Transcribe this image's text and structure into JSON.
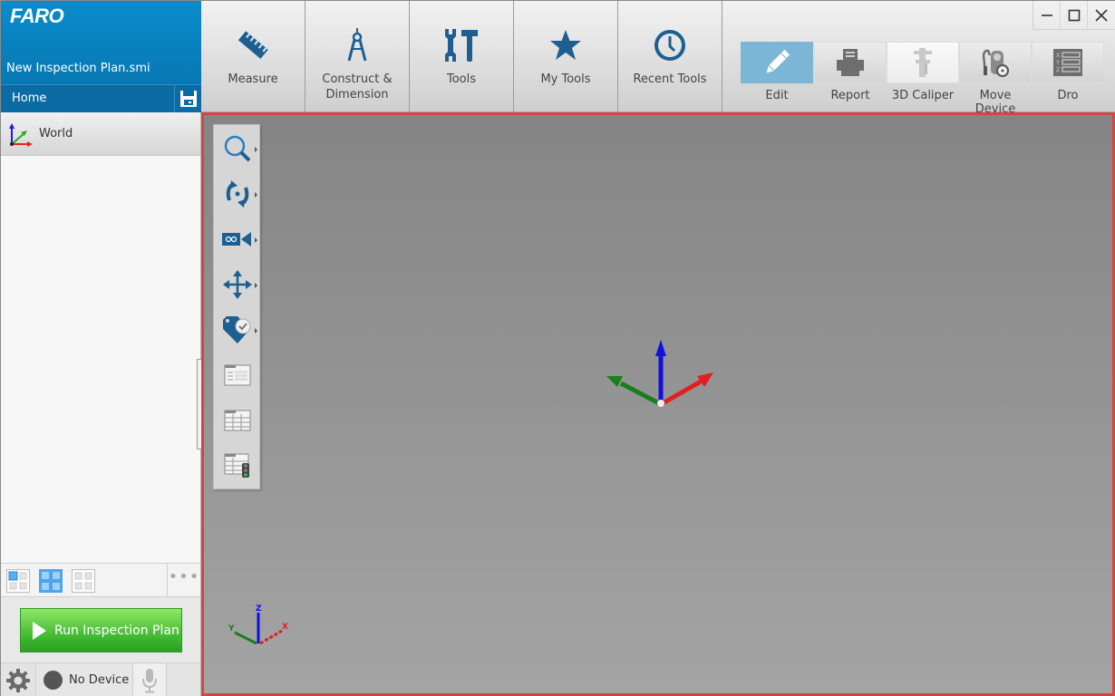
{
  "app": {
    "logo": "FARO",
    "plan_name": "New Inspection Plan.smi",
    "home_label": "Home"
  },
  "tree": {
    "root": {
      "label": "World",
      "icon": "coordinate-axes-icon"
    }
  },
  "ribbon": {
    "groups": [
      {
        "label": "Measure",
        "icon": "ruler-icon"
      },
      {
        "label": "Construct &\nDimension",
        "icon": "compass-icon"
      },
      {
        "label": "Tools",
        "icon": "wrench-hammer-icon"
      },
      {
        "label": "My Tools",
        "icon": "star-icon"
      },
      {
        "label": "Recent Tools",
        "icon": "clock-icon"
      }
    ],
    "quick_actions": [
      {
        "label": "Edit",
        "icon": "pencil-icon",
        "state": "active"
      },
      {
        "label": "Report",
        "icon": "printer-icon",
        "state": "normal"
      },
      {
        "label": "3D Caliper",
        "icon": "caliper-icon",
        "state": "disabled"
      },
      {
        "label": "Move Device",
        "icon": "move-device-icon",
        "state": "normal"
      },
      {
        "label": "Dro",
        "icon": "dro-icon",
        "state": "normal"
      }
    ]
  },
  "window_controls": {
    "minimize": "minimize-icon",
    "maximize": "maximize-icon",
    "close": "close-icon"
  },
  "viewport_tools": [
    {
      "name": "zoom",
      "icon": "magnifier-icon",
      "has_submenu": true
    },
    {
      "name": "rotate",
      "icon": "rotate-icon",
      "has_submenu": true
    },
    {
      "name": "camera",
      "icon": "camera-icon",
      "has_submenu": true
    },
    {
      "name": "pan",
      "icon": "move-arrows-icon",
      "has_submenu": true
    },
    {
      "name": "tag-check",
      "icon": "tag-check-icon",
      "has_submenu": true
    },
    {
      "name": "list-view",
      "icon": "list-window-icon",
      "has_submenu": false
    },
    {
      "name": "table-view",
      "icon": "table-window-icon",
      "has_submenu": false
    },
    {
      "name": "table-traffic",
      "icon": "table-traffic-light-icon",
      "has_submenu": false
    }
  ],
  "mini_triad": {
    "x": "X",
    "y": "Y",
    "z": "Z"
  },
  "layout_bar": {
    "layouts": [
      "layout-single",
      "layout-quad",
      "layout-none"
    ],
    "active": 1,
    "more": "•••"
  },
  "run_button": {
    "label": "Run Inspection Plan"
  },
  "status": {
    "device_label": "No Device"
  },
  "colors": {
    "brand_blue": "#0a8ccb",
    "home_blue": "#0b6ba4",
    "accent_icon": "#1d5f91",
    "viewport_border": "#d64545",
    "run_green": "#3cb52f",
    "edit_active": "#7bb6d6"
  }
}
